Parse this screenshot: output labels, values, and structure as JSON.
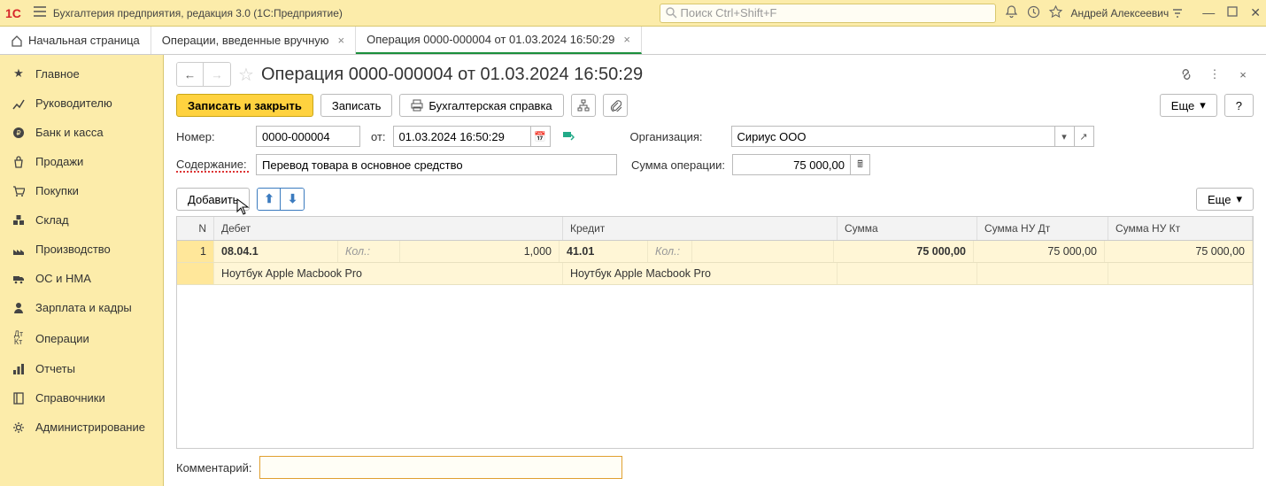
{
  "titlebar": {
    "app_title": "Бухгалтерия предприятия, редакция 3.0  (1С:Предприятие)",
    "search_placeholder": "Поиск Ctrl+Shift+F",
    "username": "Андрей Алексеевич"
  },
  "tabs": {
    "home": "Начальная страница",
    "t1": "Операции, введенные вручную",
    "t2": "Операция 0000-000004 от 01.03.2024 16:50:29"
  },
  "sidebar": {
    "items": [
      {
        "label": "Главное"
      },
      {
        "label": "Руководителю"
      },
      {
        "label": "Банк и касса"
      },
      {
        "label": "Продажи"
      },
      {
        "label": "Покупки"
      },
      {
        "label": "Склад"
      },
      {
        "label": "Производство"
      },
      {
        "label": "ОС и НМА"
      },
      {
        "label": "Зарплата и кадры"
      },
      {
        "label": "Операции"
      },
      {
        "label": "Отчеты"
      },
      {
        "label": "Справочники"
      },
      {
        "label": "Администрирование"
      }
    ]
  },
  "doc": {
    "title": "Операция 0000-000004 от 01.03.2024 16:50:29",
    "save_close": "Записать и закрыть",
    "save": "Записать",
    "report": "Бухгалтерская справка",
    "more": "Еще",
    "help": "?",
    "number_label": "Номер:",
    "number": "0000-000004",
    "from_label": "от:",
    "date": "01.03.2024 16:50:29",
    "org_label": "Организация:",
    "org": "Сириус ООО",
    "content_label": "Содержание:",
    "content": "Перевод товара в основное средство",
    "sum_label": "Сумма операции:",
    "sum": "75 000,00",
    "add": "Добавить",
    "table_more": "Еще",
    "comment_label": "Комментарий:",
    "comment": ""
  },
  "grid": {
    "headers": {
      "n": "N",
      "debit": "Дебет",
      "credit": "Кредит",
      "sum": "Сумма",
      "sum_nu_dt": "Сумма НУ Дт",
      "sum_nu_kt": "Сумма НУ Кт"
    },
    "row": {
      "n": "1",
      "debit_acc": "08.04.1",
      "qty_label": "Кол.:",
      "debit_qty": "1,000",
      "credit_acc": "41.01",
      "credit_qty": "",
      "sum": "75 000,00",
      "sum_nu_dt": "75 000,00",
      "sum_nu_kt": "75 000,00",
      "debit_item": "Ноутбук Apple Macbook Pro",
      "credit_item": "Ноутбук Apple Macbook Pro"
    }
  }
}
